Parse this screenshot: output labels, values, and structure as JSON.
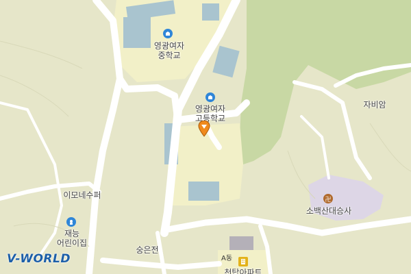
{
  "map": {
    "logo": "V-WORLD",
    "places": [
      {
        "id": "girls-middle",
        "name_lines": [
          "영광여자",
          "중학교"
        ],
        "icon": "school-icon"
      },
      {
        "id": "girls-high",
        "name_lines": [
          "영광여자",
          "고등학교"
        ],
        "icon": "school-icon"
      },
      {
        "id": "jabiam",
        "name_lines": [
          "자비암"
        ]
      },
      {
        "id": "imone",
        "name_lines": [
          "이모네수퍼"
        ]
      },
      {
        "id": "jaeneung",
        "name_lines": [
          "재능",
          "어린이집"
        ],
        "icon": "kindergarten-icon"
      },
      {
        "id": "soonhyun",
        "name_lines": [
          "숭은전"
        ]
      },
      {
        "id": "sobaeksan",
        "name_lines": [
          "소백산대승사"
        ],
        "icon": "temple-icon"
      },
      {
        "id": "apartment",
        "name_lines": [
          "천탑아파트"
        ],
        "icon": "apartment-icon"
      }
    ],
    "building_label": "A동",
    "colors": {
      "land": "#e6e6c9",
      "forest": "#c8d8a4",
      "campus": "#f2f0c8",
      "road": "#ffffff",
      "building": "#a9c4cf",
      "temple_area": "#ddd6e6",
      "pin": "#f08a1c",
      "school_icon": "#2f86d8",
      "logo": "#1d5fa8"
    }
  }
}
